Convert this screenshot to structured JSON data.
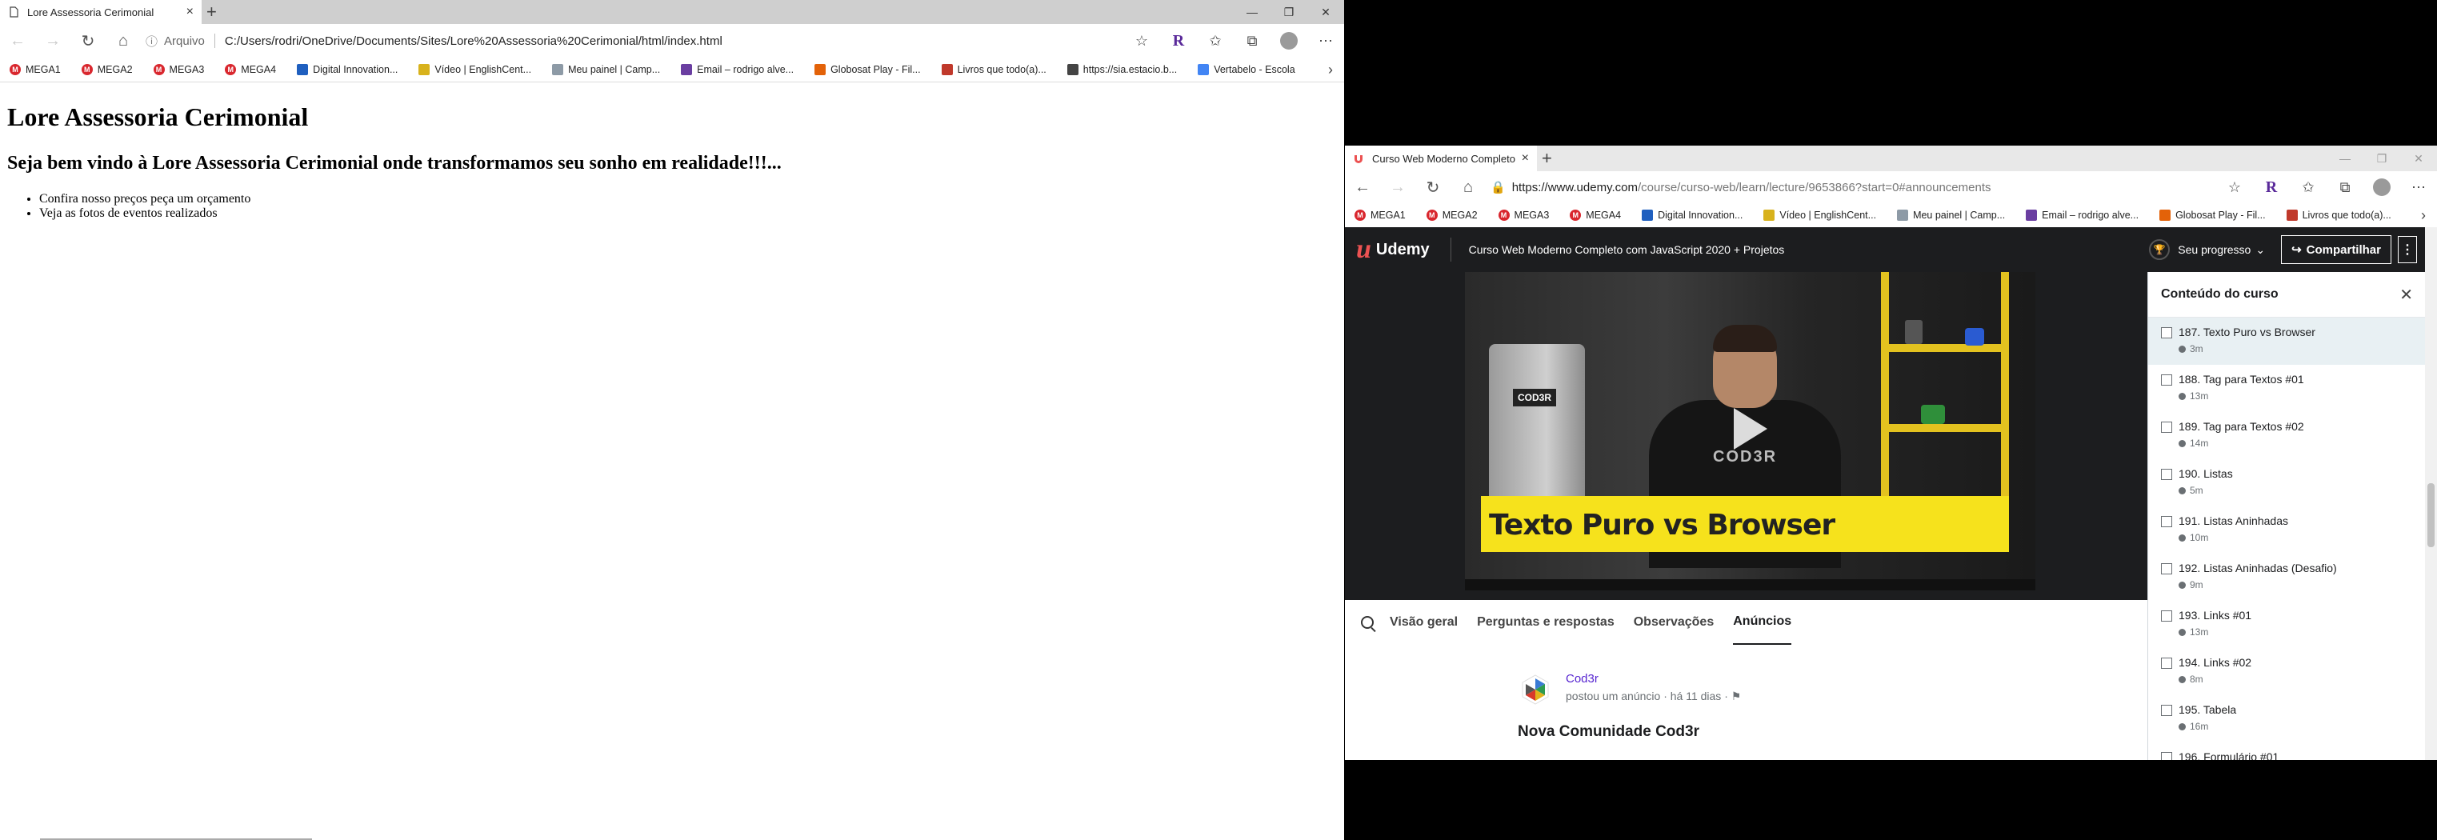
{
  "left_window": {
    "tab_title": "Lore Assessoria Cerimonial",
    "address_scheme": "Arquivo",
    "address_url": "C:/Users/rodri/OneDrive/Documents/Sites/Lore%20Assessoria%20Cerimonial/html/index.html",
    "bookmarks": [
      "MEGA1",
      "MEGA2",
      "MEGA3",
      "MEGA4",
      "Digital Innovation...",
      "Vídeo | EnglishCent...",
      "Meu painel | Camp...",
      "Email – rodrigo alve...",
      "Globosat Play - Fil...",
      "Livros que todo(a)...",
      "https://sia.estacio.b...",
      "Vertabelo - Escola"
    ],
    "page": {
      "h1": "Lore Assessoria Cerimonial",
      "h2": "Seja bem vindo à Lore Assessoria Cerimonial onde transformamos seu sonho em realidade!!!...",
      "list": [
        "Confira nosso preços peça um orçamento",
        "Veja as fotos de eventos realizados"
      ]
    }
  },
  "right_window": {
    "tab_title": "Curso Web Moderno Completo",
    "address_host": "https://www.udemy.com",
    "address_path": "/course/curso-web/learn/lecture/9653866?start=0#announcements",
    "bookmarks": [
      "MEGA1",
      "MEGA2",
      "MEGA3",
      "MEGA4",
      "Digital Innovation...",
      "Vídeo | EnglishCent...",
      "Meu painel | Camp...",
      "Email – rodrigo alve...",
      "Globosat Play - Fil...",
      "Livros que todo(a)..."
    ],
    "header": {
      "logo": "Udemy",
      "course_title": "Curso Web Moderno Completo com JavaScript 2020 + Projetos",
      "progress_label": "Seu progresso",
      "share_label": "Compartilhar"
    },
    "video": {
      "monitor_label": "COD3R",
      "shirt_text": "COD3R",
      "banner_text": "Texto Puro vs Browser"
    },
    "tabs": [
      "Visão geral",
      "Perguntas e respostas",
      "Observações",
      "Anúncios"
    ],
    "active_tab": "Anúncios",
    "announcement": {
      "author": "Cod3r",
      "meta": "postou um anúncio · há 11 dias ·",
      "title": "Nova Comunidade Cod3r"
    },
    "sidebar": {
      "title": "Conteúdo do curso",
      "lectures": [
        {
          "title": "187. Texto Puro vs Browser",
          "duration": "3m"
        },
        {
          "title": "188. Tag para Textos #01",
          "duration": "13m"
        },
        {
          "title": "189. Tag para Textos #02",
          "duration": "14m"
        },
        {
          "title": "190. Listas",
          "duration": "5m"
        },
        {
          "title": "191. Listas Aninhadas",
          "duration": "10m"
        },
        {
          "title": "192. Listas Aninhadas (Desafio)",
          "duration": "9m"
        },
        {
          "title": "193. Links #01",
          "duration": "13m"
        },
        {
          "title": "194. Links #02",
          "duration": "8m"
        },
        {
          "title": "195. Tabela",
          "duration": "16m"
        },
        {
          "title": "196. Formulário #01",
          "duration": ""
        }
      ]
    }
  },
  "colors": {
    "udemy_dark": "#1c1d1f",
    "udemy_red": "#ec5252",
    "udemy_purple": "#5624d0",
    "banner_yellow": "#f6e21c",
    "current_lecture_bg": "#e8f0f3"
  }
}
